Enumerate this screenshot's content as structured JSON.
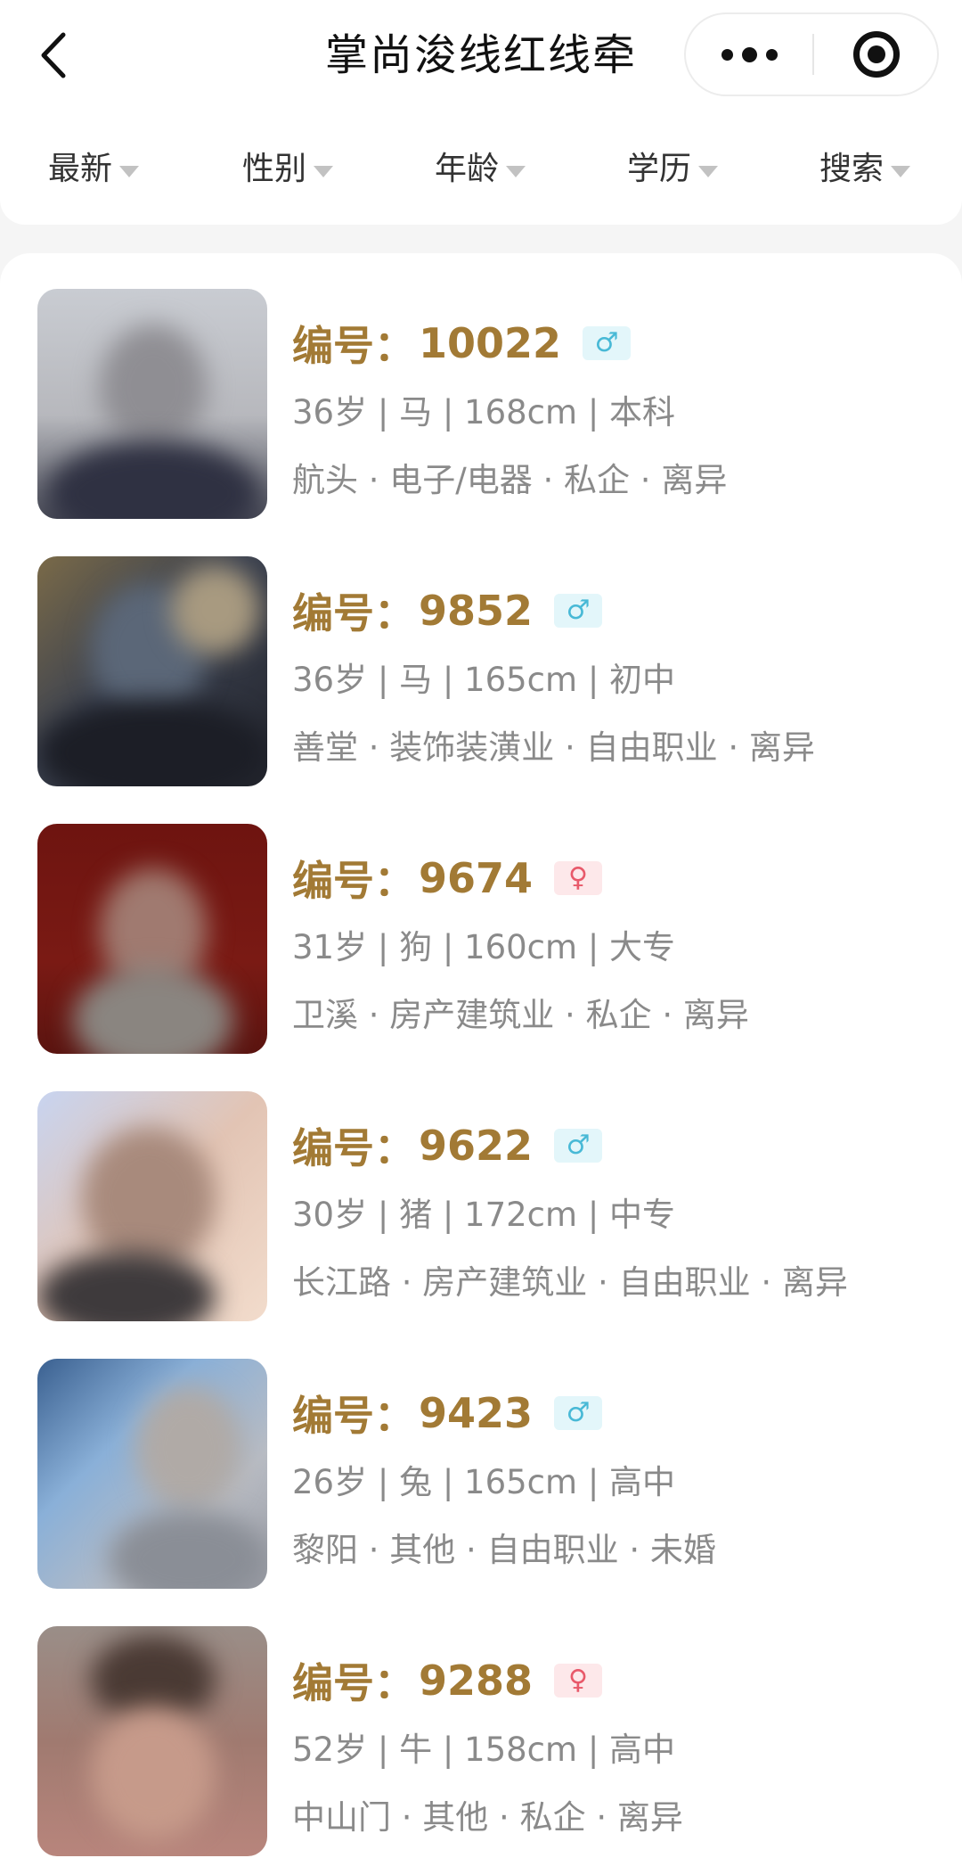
{
  "nav": {
    "title": "掌尚浚线红线牵",
    "back_icon": "chevron-left-icon",
    "more_icon": "more-dots-icon",
    "close_icon": "target-circle-icon"
  },
  "filters": [
    {
      "label": "最新"
    },
    {
      "label": "性别"
    },
    {
      "label": "年龄"
    },
    {
      "label": "学历"
    },
    {
      "label": "搜索"
    }
  ],
  "id_prefix": "编号：",
  "colors": {
    "id_text": "#a27a35",
    "meta_text": "#8a8a8a",
    "male_badge_bg": "#e3f6fa",
    "male_badge_fg": "#48b9d6",
    "female_badge_bg": "#fde8ea",
    "female_badge_fg": "#e8596a"
  },
  "profiles": [
    {
      "id": "10022",
      "gender": "male",
      "gender_symbol": "♂",
      "stats": "36岁 | 马 | 168cm | 本科",
      "details": "航头 · 电子/电器 · 私企 · 离异"
    },
    {
      "id": "9852",
      "gender": "male",
      "gender_symbol": "♂",
      "stats": "36岁 | 马 | 165cm | 初中",
      "details": "善堂 · 装饰装潢业 · 自由职业 · 离异"
    },
    {
      "id": "9674",
      "gender": "female",
      "gender_symbol": "♀",
      "stats": "31岁 | 狗 | 160cm | 大专",
      "details": "卫溪 · 房产建筑业 · 私企 · 离异"
    },
    {
      "id": "9622",
      "gender": "male",
      "gender_symbol": "♂",
      "stats": "30岁 | 猪 | 172cm | 中专",
      "details": "长江路 · 房产建筑业 · 自由职业 · 离异"
    },
    {
      "id": "9423",
      "gender": "male",
      "gender_symbol": "♂",
      "stats": "26岁 | 兔 | 165cm | 高中",
      "details": "黎阳 · 其他 · 自由职业 · 未婚"
    },
    {
      "id": "9288",
      "gender": "female",
      "gender_symbol": "♀",
      "stats": "52岁 | 牛 | 158cm | 高中",
      "details": "中山门 · 其他 · 私企 · 离异"
    }
  ]
}
